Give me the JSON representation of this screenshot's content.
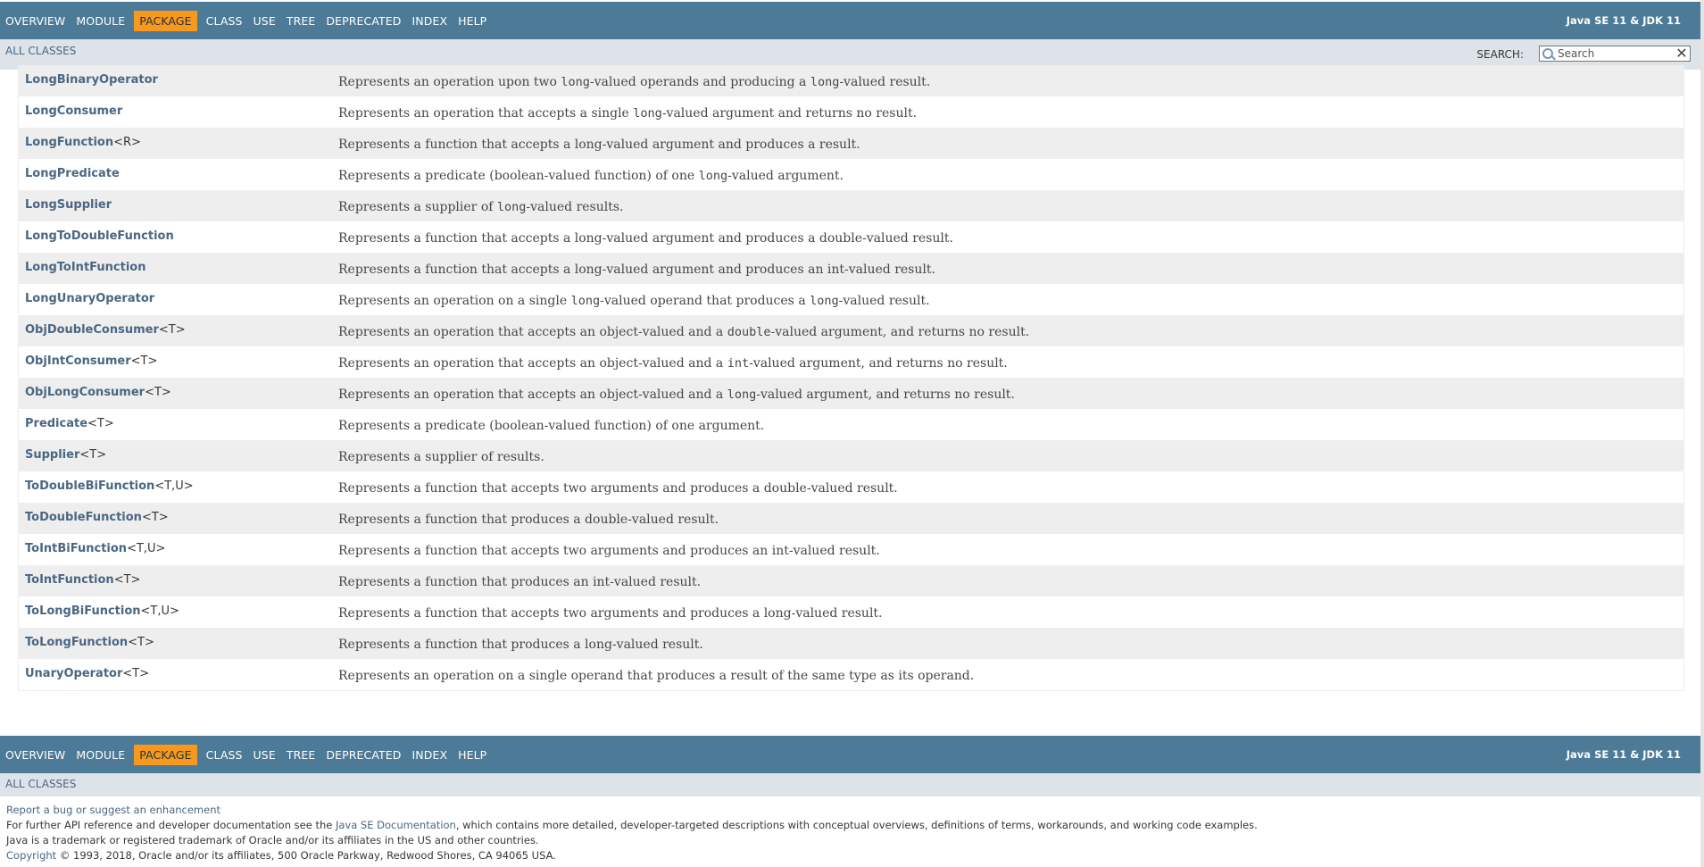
{
  "nav": {
    "items": [
      "OVERVIEW",
      "MODULE",
      "PACKAGE",
      "CLASS",
      "USE",
      "TREE",
      "DEPRECATED",
      "INDEX",
      "HELP"
    ],
    "active": "PACKAGE",
    "about": "Java SE 11 & JDK 11",
    "all_classes": "ALL CLASSES"
  },
  "search": {
    "label": "SEARCH:",
    "placeholder": "Search"
  },
  "rows": [
    {
      "name": "LongBinaryOperator",
      "params": "",
      "desc": [
        [
          "t",
          "Represents an operation upon two "
        ],
        [
          "c",
          "long"
        ],
        [
          "t",
          "-valued operands and producing a "
        ],
        [
          "c",
          "long"
        ],
        [
          "t",
          "-valued result."
        ]
      ]
    },
    {
      "name": "LongConsumer",
      "params": "",
      "desc": [
        [
          "t",
          "Represents an operation that accepts a single "
        ],
        [
          "c",
          "long"
        ],
        [
          "t",
          "-valued argument and returns no result."
        ]
      ]
    },
    {
      "name": "LongFunction",
      "params": "<R>",
      "desc": [
        [
          "t",
          "Represents a function that accepts a long-valued argument and produces a result."
        ]
      ]
    },
    {
      "name": "LongPredicate",
      "params": "",
      "desc": [
        [
          "t",
          "Represents a predicate (boolean-valued function) of one "
        ],
        [
          "c",
          "long"
        ],
        [
          "t",
          "-valued argument."
        ]
      ]
    },
    {
      "name": "LongSupplier",
      "params": "",
      "desc": [
        [
          "t",
          "Represents a supplier of "
        ],
        [
          "c",
          "long"
        ],
        [
          "t",
          "-valued results."
        ]
      ]
    },
    {
      "name": "LongToDoubleFunction",
      "params": "",
      "desc": [
        [
          "t",
          "Represents a function that accepts a long-valued argument and produces a double-valued result."
        ]
      ]
    },
    {
      "name": "LongToIntFunction",
      "params": "",
      "desc": [
        [
          "t",
          "Represents a function that accepts a long-valued argument and produces an int-valued result."
        ]
      ]
    },
    {
      "name": "LongUnaryOperator",
      "params": "",
      "desc": [
        [
          "t",
          "Represents an operation on a single "
        ],
        [
          "c",
          "long"
        ],
        [
          "t",
          "-valued operand that produces a "
        ],
        [
          "c",
          "long"
        ],
        [
          "t",
          "-valued result."
        ]
      ]
    },
    {
      "name": "ObjDoubleConsumer",
      "params": "<T>",
      "desc": [
        [
          "t",
          "Represents an operation that accepts an object-valued and a "
        ],
        [
          "c",
          "double"
        ],
        [
          "t",
          "-valued argument, and returns no result."
        ]
      ]
    },
    {
      "name": "ObjIntConsumer",
      "params": "<T>",
      "desc": [
        [
          "t",
          "Represents an operation that accepts an object-valued and a "
        ],
        [
          "c",
          "int"
        ],
        [
          "t",
          "-valued argument, and returns no result."
        ]
      ]
    },
    {
      "name": "ObjLongConsumer",
      "params": "<T>",
      "desc": [
        [
          "t",
          "Represents an operation that accepts an object-valued and a "
        ],
        [
          "c",
          "long"
        ],
        [
          "t",
          "-valued argument, and returns no result."
        ]
      ]
    },
    {
      "name": "Predicate",
      "params": "<T>",
      "desc": [
        [
          "t",
          "Represents a predicate (boolean-valued function) of one argument."
        ]
      ]
    },
    {
      "name": "Supplier",
      "params": "<T>",
      "desc": [
        [
          "t",
          "Represents a supplier of results."
        ]
      ]
    },
    {
      "name": "ToDoubleBiFunction",
      "params": "<T,U>",
      "desc": [
        [
          "t",
          "Represents a function that accepts two arguments and produces a double-valued result."
        ]
      ]
    },
    {
      "name": "ToDoubleFunction",
      "params": "<T>",
      "desc": [
        [
          "t",
          "Represents a function that produces a double-valued result."
        ]
      ]
    },
    {
      "name": "ToIntBiFunction",
      "params": "<T,U>",
      "desc": [
        [
          "t",
          "Represents a function that accepts two arguments and produces an int-valued result."
        ]
      ]
    },
    {
      "name": "ToIntFunction",
      "params": "<T>",
      "desc": [
        [
          "t",
          "Represents a function that produces an int-valued result."
        ]
      ]
    },
    {
      "name": "ToLongBiFunction",
      "params": "<T,U>",
      "desc": [
        [
          "t",
          "Represents a function that accepts two arguments and produces a long-valued result."
        ]
      ]
    },
    {
      "name": "ToLongFunction",
      "params": "<T>",
      "desc": [
        [
          "t",
          "Represents a function that produces a long-valued result."
        ]
      ]
    },
    {
      "name": "UnaryOperator",
      "params": "<T>",
      "desc": [
        [
          "t",
          "Represents an operation on a single operand that produces a result of the same type as its operand."
        ]
      ]
    }
  ],
  "footer": {
    "bug_link": "Report a bug or suggest an enhancement",
    "line2_pre": "For further API reference and developer documentation see the ",
    "line2_link": "Java SE Documentation",
    "line2_post": ", which contains more detailed, developer-targeted descriptions with conceptual overviews, definitions of terms, workarounds, and working code examples.",
    "line3": "Java is a trademark or registered trademark of Oracle and/or its affiliates in the US and other countries.",
    "line4_link": "Copyright",
    "line4_post": " © 1993, 2018, Oracle and/or its affiliates, 500 Oracle Parkway, Redwood Shores, CA 94065 USA."
  },
  "colors": {
    "nav_bg": "#4d7a97",
    "subnav_bg": "#dee3e9",
    "active_tab": "#f8981d",
    "link": "#4a6782",
    "row_alt": "#eeeeef"
  }
}
